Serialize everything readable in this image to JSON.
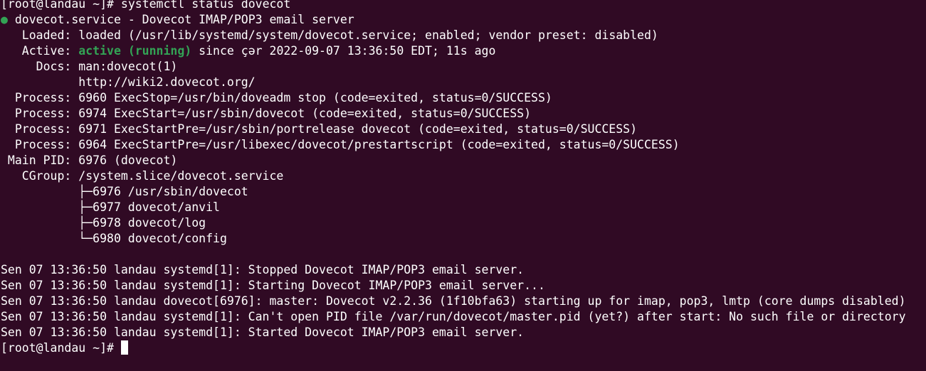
{
  "prompt": "[root@landau ~]# ",
  "command": "systemctl status dovecot",
  "service": {
    "dot": "●",
    "title": "dovecot.service - Dovecot IMAP/POP3 email server",
    "loaded_label": "   Loaded: ",
    "loaded_value": "loaded (/usr/lib/systemd/system/dovecot.service; enabled; vendor preset: disabled)",
    "active_label": "   Active: ",
    "active_state": "active (running)",
    "active_since": " since çər 2022-09-07 13:36:50 EDT; 11s ago",
    "docs_label": "     Docs: ",
    "docs_1": "man:dovecot(1)",
    "docs_2": "           http://wiki2.dovecot.org/",
    "process_lines": [
      "  Process: 6960 ExecStop=/usr/bin/doveadm stop (code=exited, status=0/SUCCESS)",
      "  Process: 6974 ExecStart=/usr/sbin/dovecot (code=exited, status=0/SUCCESS)",
      "  Process: 6971 ExecStartPre=/usr/sbin/portrelease dovecot (code=exited, status=0/SUCCESS)",
      "  Process: 6964 ExecStartPre=/usr/libexec/dovecot/prestartscript (code=exited, status=0/SUCCESS)"
    ],
    "main_pid": " Main PID: 6976 (dovecot)",
    "cgroup": "   CGroup: /system.slice/dovecot.service",
    "cgroup_tree": [
      "           ├─6976 /usr/sbin/dovecot",
      "           ├─6977 dovecot/anvil",
      "           ├─6978 dovecot/log",
      "           └─6980 dovecot/config"
    ]
  },
  "log_lines": [
    "Sen 07 13:36:50 landau systemd[1]: Stopped Dovecot IMAP/POP3 email server.",
    "Sen 07 13:36:50 landau systemd[1]: Starting Dovecot IMAP/POP3 email server...",
    "Sen 07 13:36:50 landau dovecot[6976]: master: Dovecot v2.2.36 (1f10bfa63) starting up for imap, pop3, lmtp (core dumps disabled)",
    "Sen 07 13:36:50 landau systemd[1]: Can't open PID file /var/run/dovecot/master.pid (yet?) after start: No such file or directory",
    "Sen 07 13:36:50 landau systemd[1]: Started Dovecot IMAP/POP3 email server."
  ],
  "colors": {
    "background": "#300a24",
    "foreground": "#ffffff",
    "active_green": "#33a355"
  }
}
